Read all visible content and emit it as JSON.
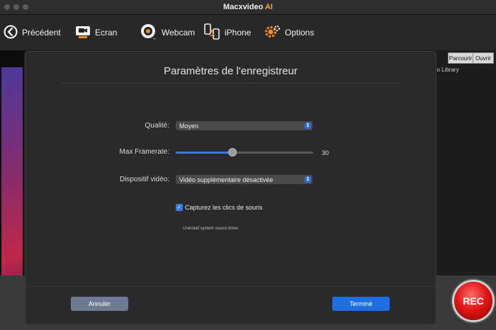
{
  "window": {
    "title_main": "Macxvideo",
    "title_accent": "AI"
  },
  "toolbar": {
    "back_label": "Précédent",
    "screen_label": "Ecran",
    "webcam_label": "Webcam",
    "iphone_label": "iPhone",
    "options_label": "Options"
  },
  "right_panel": {
    "browse_button": "Parcourir",
    "open_button": "Ouvrir",
    "library_label": "eo Library"
  },
  "record_button": "REC",
  "dialog": {
    "title": "Paramètres de l'enregistreur",
    "quality_label": "Qualité:",
    "quality_value": "Moyen",
    "framerate_label": "Max Framerate:",
    "framerate_value": "30",
    "framerate_fraction": 0.41,
    "device_label": "Dispositif vidéo:",
    "device_value": "Vidéo supplémentaire désactivée",
    "mouse_clicks_label": "Capturez les clics de souris",
    "mouse_clicks_checked": true,
    "uninstall_link": "Uninstall system sound driver",
    "cancel_button": "Annuler",
    "done_button": "Terminé"
  },
  "colors": {
    "accent_blue": "#1f6fe0",
    "title_accent": "#f2a13a",
    "rec_red": "#e01818"
  }
}
